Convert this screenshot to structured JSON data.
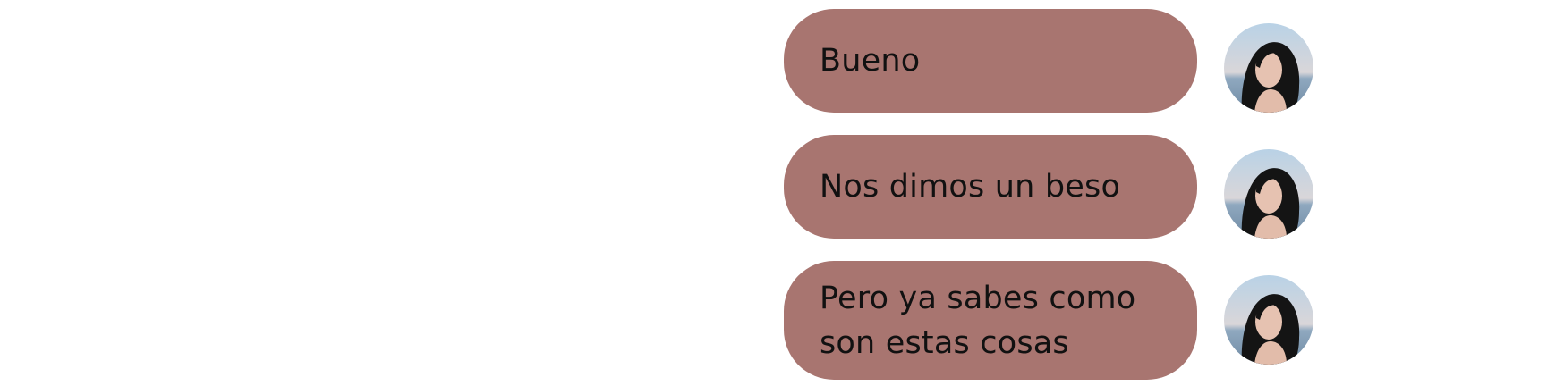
{
  "theme": {
    "bubble_color": "#a87570",
    "background": "#ffffff",
    "text_color": "#111111"
  },
  "messages": [
    {
      "text": "Bueno",
      "avatar_icon": "user-avatar-photo"
    },
    {
      "text": "Nos dimos un beso",
      "avatar_icon": "user-avatar-photo"
    },
    {
      "text": "Pero ya sabes como son estas cosas",
      "avatar_icon": "user-avatar-photo"
    }
  ]
}
